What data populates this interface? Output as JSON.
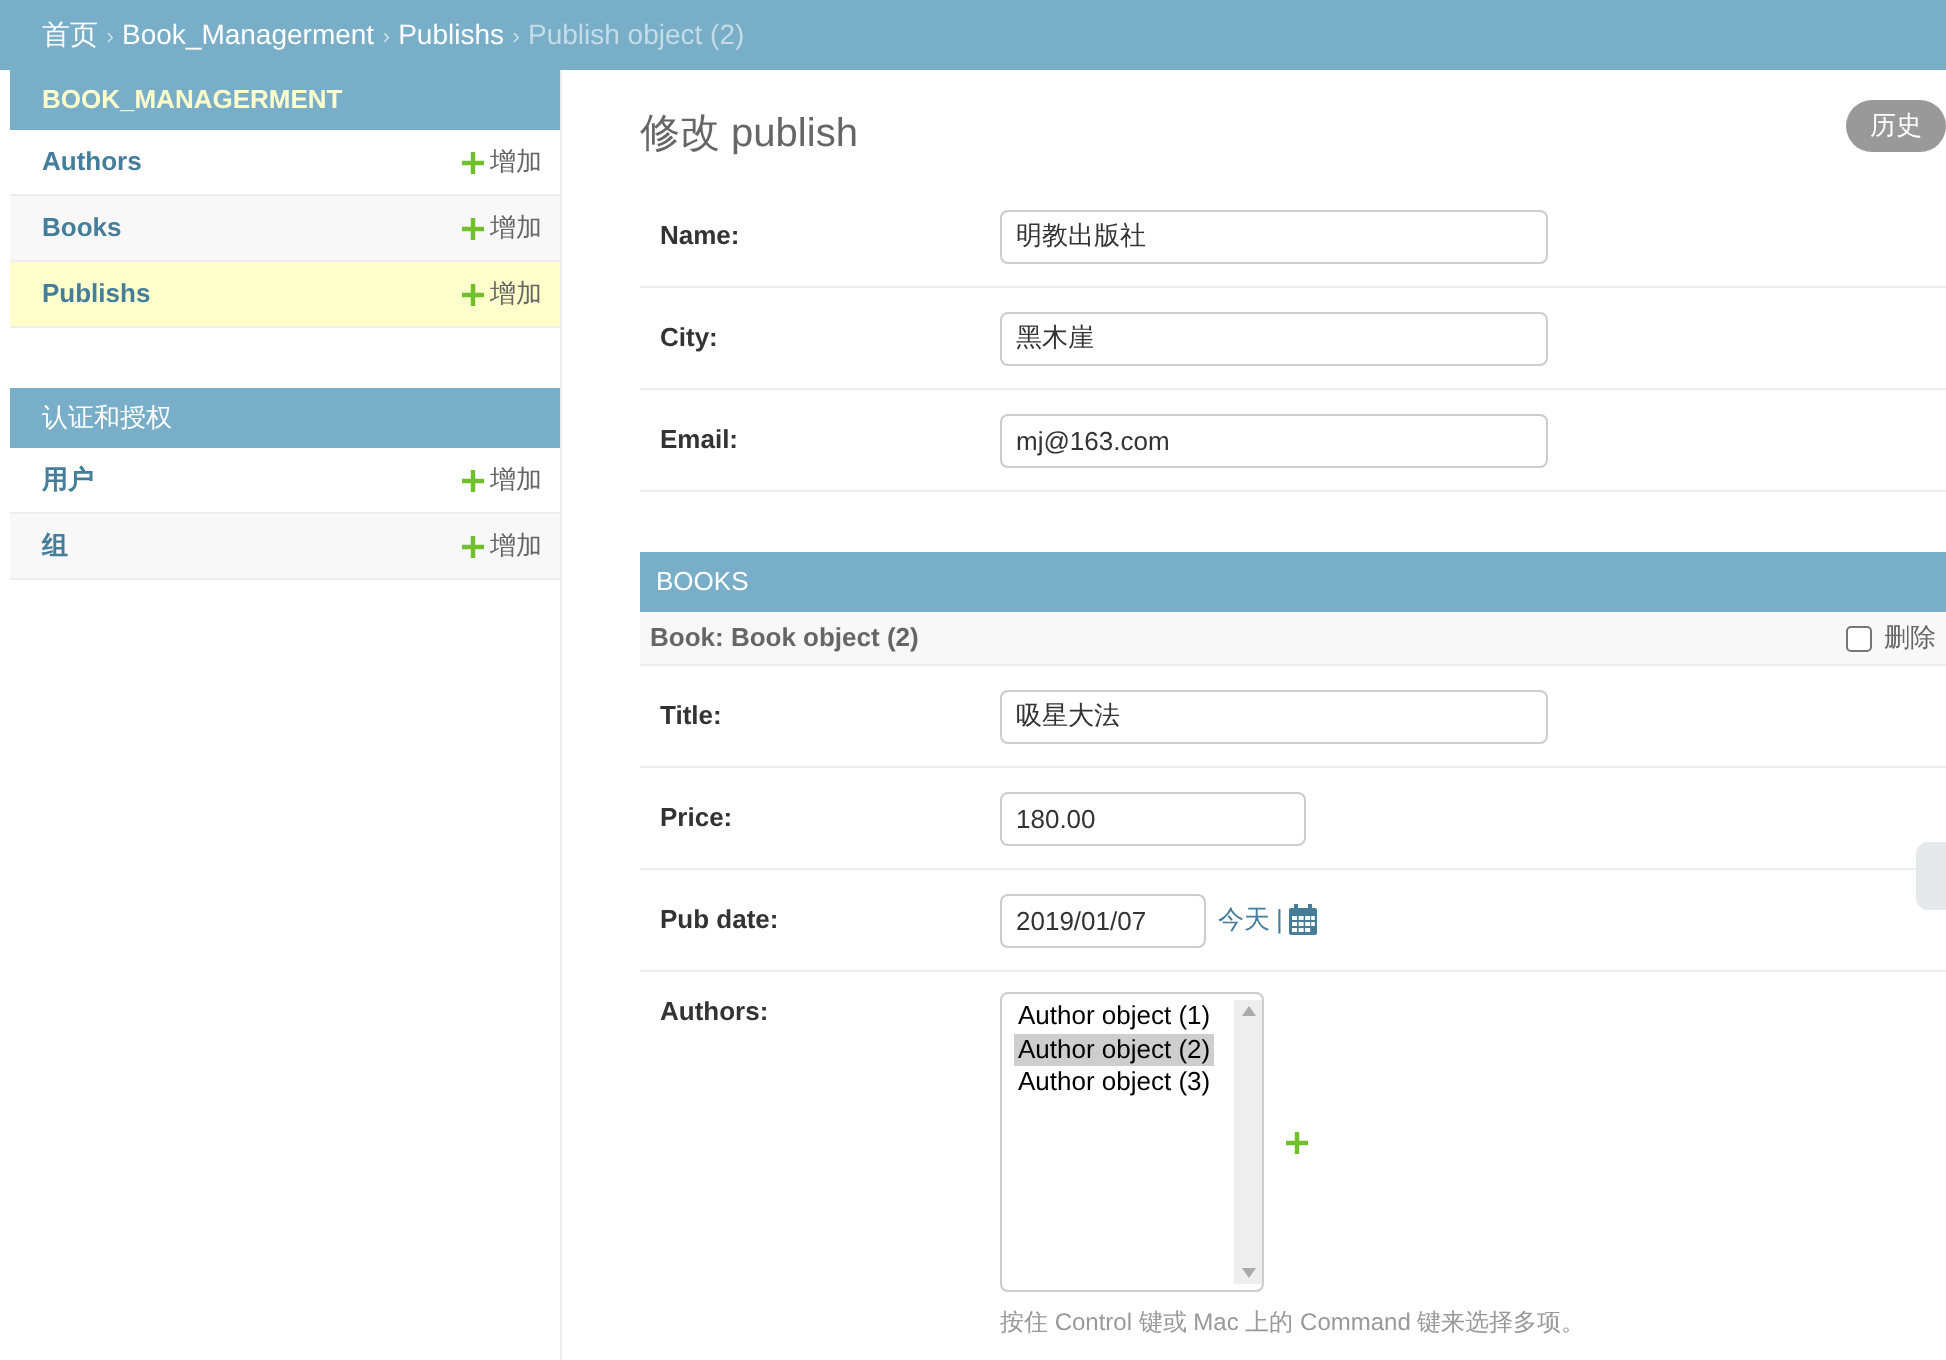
{
  "breadcrumbs": [
    {
      "label": "首页",
      "current": false
    },
    {
      "label": "Book_Managerment",
      "current": false
    },
    {
      "label": "Publishs",
      "current": false
    },
    {
      "label": "Publish object (2)",
      "current": true
    }
  ],
  "breadcrumb_separator": "›",
  "sidebar": {
    "modules": [
      {
        "title": "BOOK_MANAGERMENT",
        "selected": true,
        "models": [
          {
            "name": "Authors",
            "selected": false,
            "add_label": "增加"
          },
          {
            "name": "Books",
            "selected": false,
            "add_label": "增加"
          },
          {
            "name": "Publishs",
            "selected": true,
            "add_label": "增加"
          }
        ]
      },
      {
        "title": "认证和授权",
        "selected": false,
        "models": [
          {
            "name": "用户",
            "selected": false,
            "add_label": "增加"
          },
          {
            "name": "组",
            "selected": false,
            "add_label": "增加"
          }
        ]
      }
    ]
  },
  "page_title": "修改 publish",
  "history_button": "历史",
  "fields": [
    {
      "label": "Name:",
      "kind": "text",
      "value": "明教出版社"
    },
    {
      "label": "City:",
      "kind": "text",
      "value": "黑木崖"
    },
    {
      "label": "Email:",
      "kind": "text",
      "value": "mj@163.com"
    }
  ],
  "inline": {
    "title": "BOOKS",
    "object_title": "Book: Book object (2)",
    "delete_label": "删除",
    "delete_checked": false,
    "fields": [
      {
        "label": "Title:",
        "kind": "text",
        "value": "吸星大法"
      },
      {
        "label": "Price:",
        "kind": "number",
        "value": "180.00"
      },
      {
        "label": "Pub date:",
        "kind": "date",
        "value": "2019/01/07",
        "today_label": "今天",
        "separator": "|"
      },
      {
        "label": "Authors:",
        "kind": "multiselect",
        "options": [
          {
            "label": "Author object (1)",
            "selected": false
          },
          {
            "label": "Author object (2)",
            "selected": true
          },
          {
            "label": "Author object (3)",
            "selected": false
          }
        ],
        "help": "按住 Control 键或 Mac 上的 Command 键来选择多项。"
      }
    ]
  }
}
